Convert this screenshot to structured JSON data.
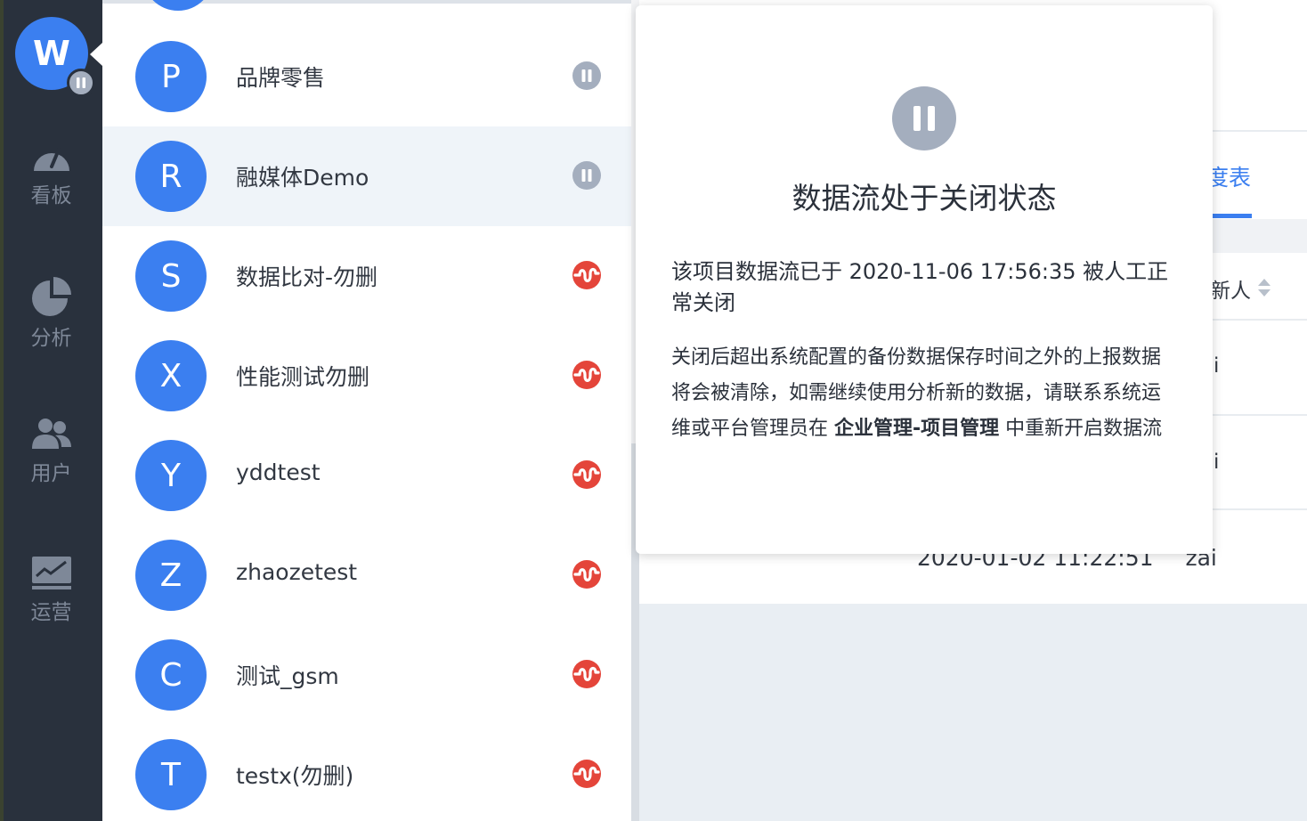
{
  "colors": {
    "nav_bg": "#29313d",
    "accent": "#3b7ff0",
    "paused_gray": "#a4aebe",
    "running_red": "#e4453a",
    "selected_row": "#eff4f9"
  },
  "current_project": {
    "letter": "W",
    "status_icon": "pause-icon"
  },
  "nav": {
    "items": [
      {
        "label": "看板",
        "icon": "dashboard-gauge-icon"
      },
      {
        "label": "分析",
        "icon": "pie-chart-icon"
      },
      {
        "label": "用户",
        "icon": "users-icon"
      },
      {
        "label": "运营",
        "icon": "operations-chart-icon"
      }
    ]
  },
  "projects": [
    {
      "letter": "P",
      "name": "品牌零售",
      "status": "paused",
      "selected": false
    },
    {
      "letter": "R",
      "name": "融媒体Demo",
      "status": "paused",
      "selected": true
    },
    {
      "letter": "S",
      "name": "数据比对-勿删",
      "status": "running",
      "selected": false
    },
    {
      "letter": "X",
      "name": "性能测试勿删",
      "status": "running",
      "selected": false
    },
    {
      "letter": "Y",
      "name": "yddtest",
      "status": "running",
      "selected": false
    },
    {
      "letter": "Z",
      "name": "zhaozetest",
      "status": "running",
      "selected": false
    },
    {
      "letter": "C",
      "name": "测试_gsm",
      "status": "running",
      "selected": false
    },
    {
      "letter": "T",
      "name": "testx(勿删)",
      "status": "running",
      "selected": false
    }
  ],
  "background": {
    "tab_label": "度表",
    "column_label": "新人",
    "cell_values": [
      "i",
      "i"
    ],
    "last_row_time": "2020-01-02 11:22:51",
    "last_row_user": "zai"
  },
  "popover": {
    "title": "数据流处于关闭状态",
    "lead": "该项目数据流已于 2020-11-06 17:56:35 被人工正常关闭",
    "body_before": "关闭后超出系统配置的备份数据保存时间之外的上报数据将会被清除，如需继续使用分析新的数据，请联系系统运维或平台管理员在 ",
    "body_bold": "企业管理-项目管理",
    "body_after": " 中重新开启数据流"
  }
}
